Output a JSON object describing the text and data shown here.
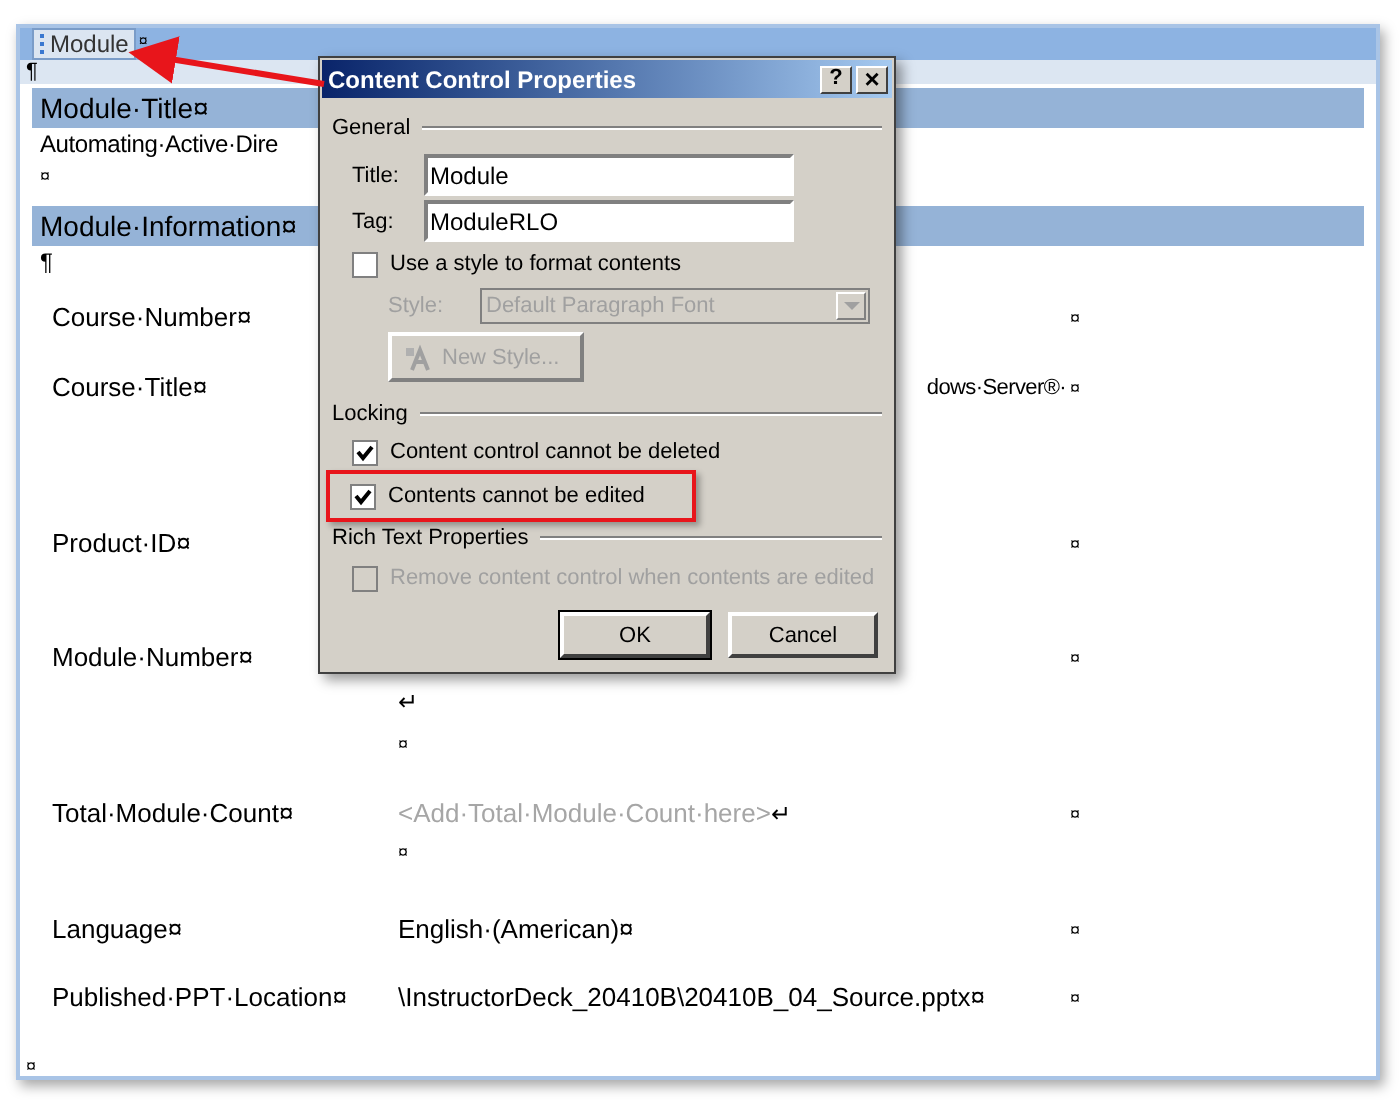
{
  "content_control": {
    "tag_label": "Module",
    "tag_mark": "¤"
  },
  "document": {
    "first_mark": "¶",
    "sections": [
      {
        "kind": "header",
        "text": "Module·Title¤"
      },
      {
        "kind": "body",
        "lines": [
          "Automating·Active·Dire",
          "¤"
        ]
      },
      {
        "kind": "header",
        "text": "Module·Information¤"
      },
      {
        "kind": "body",
        "lines": [
          "¶"
        ]
      }
    ],
    "table_rows": [
      {
        "label": "Course·Number¤",
        "value_lines": [],
        "end_mark": "¤"
      },
      {
        "label": "Course·Title¤",
        "value_lines": [
          {
            "text": "dows·Server®·",
            "kind": "cut"
          }
        ],
        "end_mark": "¤"
      },
      {
        "label": "Product·ID¤",
        "value_lines": [],
        "end_mark": "¤"
      },
      {
        "label": "Module·Number¤",
        "value_lines": [
          {
            "text": "↵",
            "kind": "covered_below"
          },
          {
            "text": "¤",
            "kind": "plain"
          }
        ],
        "end_mark": "¤"
      },
      {
        "label": "Total·Module·Count¤",
        "value_lines": [
          {
            "text": "<Add·Total·Module·Count·here>",
            "kind": "placeholder",
            "mark": "↵"
          },
          {
            "text": "¤",
            "kind": "plain"
          }
        ],
        "end_mark": "¤"
      },
      {
        "label": "Language¤",
        "value_lines": [
          {
            "text": "English·(American)¤",
            "kind": "plain"
          }
        ],
        "end_mark": "¤"
      },
      {
        "label": "Published·PPT·Location¤",
        "value_lines": [
          {
            "text": "\\InstructorDeck_20410B\\20410B_04_Source.pptx¤",
            "kind": "plain"
          }
        ],
        "end_mark": "¤"
      }
    ],
    "last_mark": "¤"
  },
  "dialog": {
    "title": "Content Control Properties",
    "help_button": "?",
    "close_button": "×",
    "general_group": "General",
    "title_field": {
      "label": "Title:",
      "value": "Module"
    },
    "tag_field": {
      "label": "Tag:",
      "value": "ModuleRLO"
    },
    "use_style": {
      "label": "Use a style to format contents",
      "checked": false,
      "disabled": false
    },
    "style_select": {
      "label": "Style:",
      "value": "Default Paragraph Font",
      "disabled": true
    },
    "new_style_button": {
      "label": "New Style...",
      "disabled": true
    },
    "locking_group": "Locking",
    "locking": [
      {
        "label": "Content control cannot be deleted",
        "checked": true,
        "disabled": false,
        "highlighted": false
      },
      {
        "label": "Contents cannot be edited",
        "checked": true,
        "disabled": false,
        "highlighted": true
      }
    ],
    "rich_text_group": "Rich Text Properties",
    "remove_control": {
      "label": "Remove content control when contents are edited",
      "checked": false,
      "disabled": true
    },
    "buttons": [
      {
        "label": "OK",
        "default": true
      },
      {
        "label": "Cancel",
        "default": false
      }
    ]
  }
}
